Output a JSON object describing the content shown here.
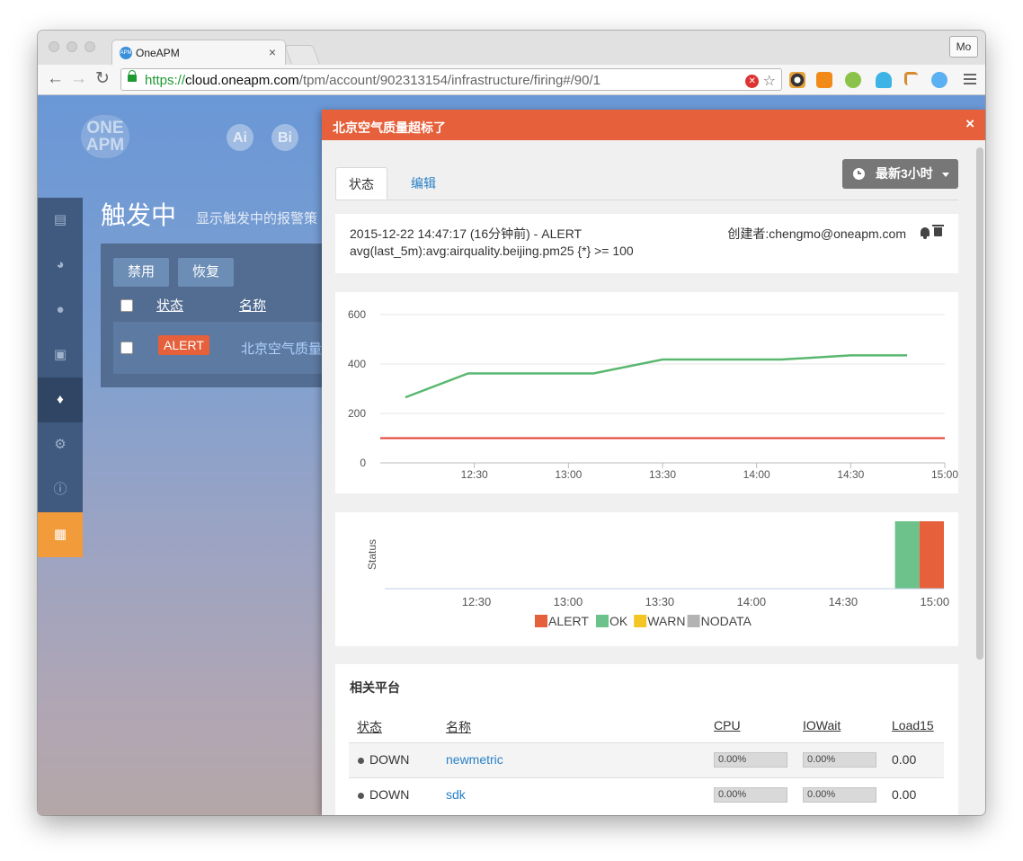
{
  "browser": {
    "tab_title": "OneAPM",
    "tab_close": "×",
    "profile": "Mo",
    "url_scheme": "https://",
    "url_host": "cloud.oneapm.com",
    "url_path": "/tpm/account/902313154/infrastructure/firing#/90/1"
  },
  "app": {
    "logo": "ONE APM",
    "icons": [
      "Ai",
      "Bi"
    ],
    "page_title": "触发中",
    "page_subtitle": "显示触发中的报警策",
    "disable_btn": "禁用",
    "restore_btn": "恢复",
    "col_status": "状态",
    "col_name": "名称",
    "row_status": "ALERT",
    "row_name": "北京空气质量超"
  },
  "modal": {
    "title": "北京空气质量超标了",
    "close": "×",
    "tab_status": "状态",
    "tab_edit": "编辑",
    "time_range": "最新3小时",
    "event_line": "2015-12-22 14:47:17  (16分钟前) - ALERT",
    "query": "avg(last_5m):avg:airquality.beijing.pm25 {*} >= 100",
    "creator": "创建者:chengmo@oneapm.com",
    "related_title": "相关平台",
    "table": {
      "headers": [
        "状态",
        "名称",
        "CPU",
        "IOWait",
        "Load15"
      ],
      "rows": [
        {
          "status": "DOWN",
          "name": "newmetric",
          "cpu": "0.00%",
          "iowait": "0.00%",
          "load": "0.00"
        },
        {
          "status": "DOWN",
          "name": "sdk",
          "cpu": "0.00%",
          "iowait": "0.00%",
          "load": "0.00"
        }
      ]
    }
  },
  "chart_data": [
    {
      "type": "line",
      "x_ticks": [
        "12:30",
        "13:00",
        "13:30",
        "14:00",
        "14:30",
        "15:00"
      ],
      "ylim": [
        0,
        600
      ],
      "y_ticks": [
        0,
        200,
        400,
        600
      ],
      "series": [
        {
          "color": "#5ab770",
          "points": [
            [
              "12:08",
              265
            ],
            [
              "12:28",
              362
            ],
            [
              "13:08",
              362
            ],
            [
              "13:30",
              418
            ],
            [
              "14:08",
              418
            ],
            [
              "14:30",
              435
            ],
            [
              "14:48",
              435
            ]
          ]
        },
        {
          "color": "#e23b2e",
          "points": [
            [
              "12:00",
              100
            ],
            [
              "15:00",
              100
            ]
          ]
        }
      ],
      "grid": true
    },
    {
      "type": "bar",
      "ylabel": "Status",
      "x_ticks": [
        "12:30",
        "13:00",
        "13:30",
        "14:00",
        "14:30",
        "15:00"
      ],
      "segments": [
        {
          "state": "OK",
          "start": "14:47",
          "end": "14:55",
          "color": "#6cc28a"
        },
        {
          "state": "ALERT",
          "start": "14:55",
          "end": "15:03",
          "color": "#e5603b"
        }
      ],
      "legend": [
        {
          "label": "ALERT",
          "color": "#e5603b"
        },
        {
          "label": "OK",
          "color": "#6cc28a"
        },
        {
          "label": "WARN",
          "color": "#f3c623"
        },
        {
          "label": "NODATA",
          "color": "#b3b3b3"
        }
      ]
    }
  ]
}
